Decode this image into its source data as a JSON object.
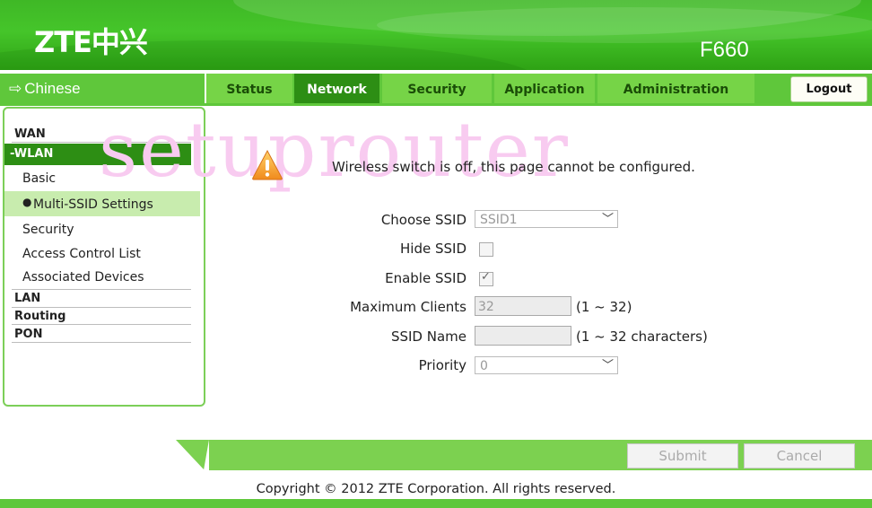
{
  "header": {
    "brand": "ZTE中兴",
    "model": "F660"
  },
  "language_link": {
    "label": "Chinese"
  },
  "tabs": [
    {
      "label": "Status"
    },
    {
      "label": "Network"
    },
    {
      "label": "Security"
    },
    {
      "label": "Application"
    },
    {
      "label": "Administration"
    }
  ],
  "active_tab": "Network",
  "logout_label": "Logout",
  "sidebar": {
    "wan": "WAN",
    "wlan": "-WLAN",
    "basic": "Basic",
    "multi_ssid": "Multi-SSID Settings",
    "security": "Security",
    "acl": "Access Control List",
    "associated": "Associated Devices",
    "lan": "LAN",
    "routing": "Routing",
    "pon": "PON"
  },
  "watermark": "setuprouter",
  "warning": {
    "icon": "warning-icon",
    "text": "Wireless switch is off, this page cannot be configured."
  },
  "form": {
    "choose_ssid": {
      "label": "Choose SSID",
      "value": "SSID1"
    },
    "hide_ssid": {
      "label": "Hide SSID",
      "checked": false
    },
    "enable_ssid": {
      "label": "Enable SSID",
      "checked": true
    },
    "max_clients": {
      "label": "Maximum Clients",
      "value": "32",
      "hint": "(1 ~ 32)"
    },
    "ssid_name": {
      "label": "SSID Name",
      "value": "",
      "hint": "(1 ~ 32 characters)"
    },
    "priority": {
      "label": "Priority",
      "value": "0"
    }
  },
  "buttons": {
    "submit": "Submit",
    "cancel": "Cancel"
  },
  "copyright": "Copyright © 2012 ZTE Corporation. All rights reserved.",
  "colors": {
    "brand_green": "#45c52a",
    "active_tab": "#2d8e14",
    "tab": "#76d447"
  }
}
